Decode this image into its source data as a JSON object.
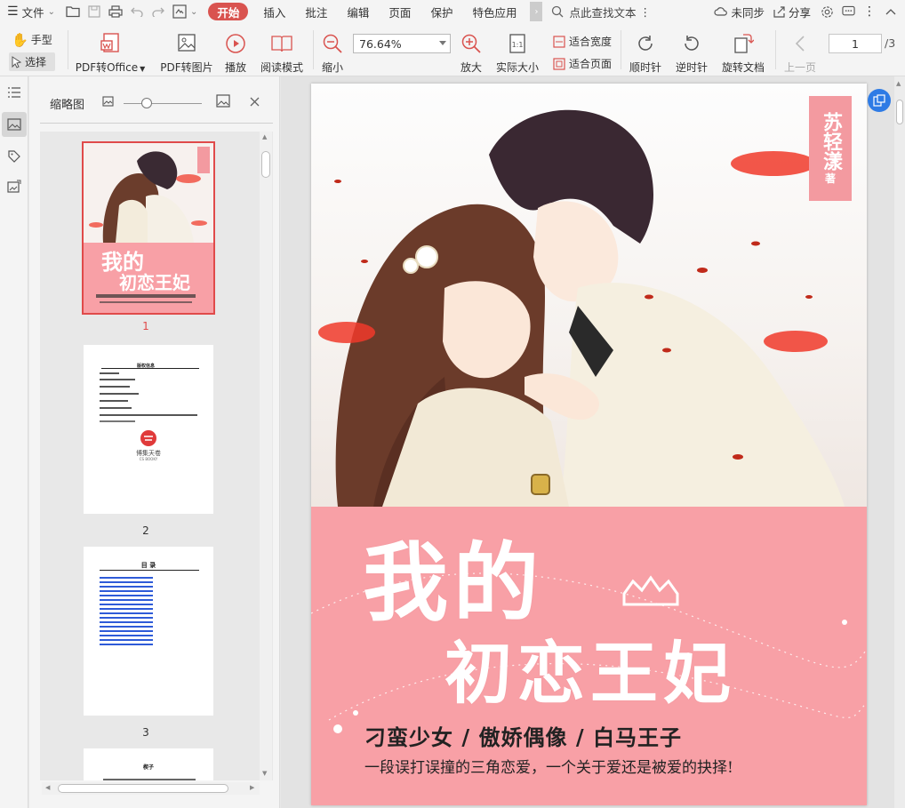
{
  "menu": {
    "file": "文件",
    "tabs": [
      "开始",
      "插入",
      "批注",
      "编辑",
      "页面",
      "保护",
      "特色应用"
    ],
    "active_tab": "开始",
    "search_placeholder": "点此查找文本",
    "sync": "未同步",
    "share": "分享"
  },
  "toolbar": {
    "hand": "手型",
    "select": "选择",
    "pdf_to_office": "PDF转Office",
    "pdf_to_image": "PDF转图片",
    "play": "播放",
    "read_mode": "阅读模式",
    "zoom_out": "缩小",
    "zoom_value": "76.64%",
    "zoom_in": "放大",
    "actual_size": "实际大小",
    "fit_width": "适合宽度",
    "fit_page": "适合页面",
    "rotate_cw": "顺时针",
    "rotate_ccw": "逆时针",
    "rotate_doc": "旋转文档",
    "prev_page": "上一页",
    "current_page": "1",
    "total_pages": "/3"
  },
  "thumbnails": {
    "title": "缩略图",
    "pages": [
      {
        "number": "1"
      },
      {
        "number": "2"
      },
      {
        "number": "3"
      }
    ],
    "page2": {
      "heading": "版权信息",
      "logo_text": "博集天卷",
      "logo_sub": "CS BOOKY"
    },
    "page3": {
      "heading": "目  录"
    },
    "page4": {
      "heading": "楔子"
    }
  },
  "document": {
    "title_line1": "我的",
    "title_line2": "初恋王妃",
    "tagline": "刁蛮少女 / 傲娇偶像 / 白马王子",
    "subline": "一段误打误撞的三角恋爱，一个关于爱还是被爱的抉择!",
    "author": "苏轻漾",
    "author_suffix": "著"
  },
  "colors": {
    "accent": "#d9534f",
    "cover_pink": "#f8a0a6",
    "link_blue": "#2e7be5"
  }
}
